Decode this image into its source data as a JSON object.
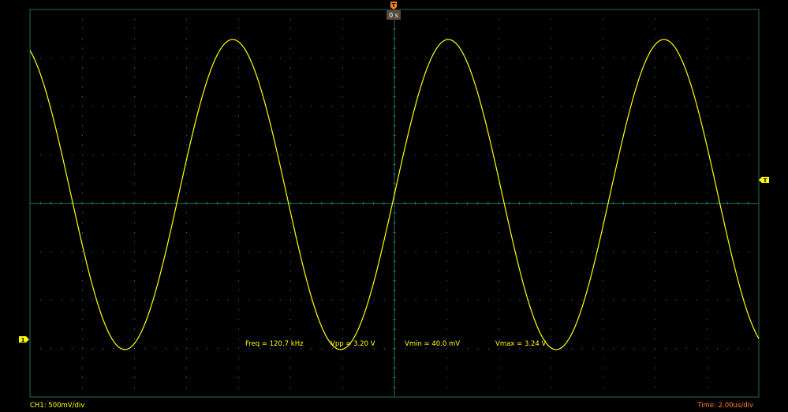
{
  "colors": {
    "background": "#000000",
    "grid": "#1f6b5a",
    "grid_dots": "#3a8f7a",
    "trace": "#ffff00",
    "trigger_marker": "#ff7f1e",
    "time_label": "#ff7f1e"
  },
  "trigger": {
    "marker_glyph": "T",
    "time_offset": "0 s",
    "level_marker_glyph": "T"
  },
  "channel": {
    "marker_glyph": "1",
    "scale_label": "CH1: 500mV/div"
  },
  "timebase": {
    "label": "Time: 2.00us/div"
  },
  "measurements": {
    "freq": "Freq = 120.7 kHz",
    "vpp": "Vpp = 3.20 V",
    "vmin": "Vmin = 40.0 mV",
    "vmax": "Vmax = 3.24 V"
  },
  "chart_data": {
    "type": "line",
    "title": "",
    "xlabel": "",
    "ylabel": "",
    "x_unit": "us",
    "y_unit": "V",
    "grid": true,
    "divisions": {
      "x": 14,
      "y": 8
    },
    "x_per_div": 2.0,
    "y_per_div": 0.5,
    "xlim": [
      -14.0,
      14.0
    ],
    "ylim": [
      -0.45,
      3.55
    ],
    "series": [
      {
        "waveform": "sine",
        "frequency_khz": 120.7,
        "vmin": 0.04,
        "vmax": 3.24,
        "vpp": 3.2,
        "phase_at_x0": "rising zero-crossing",
        "offset_v": 1.64
      }
    ]
  }
}
